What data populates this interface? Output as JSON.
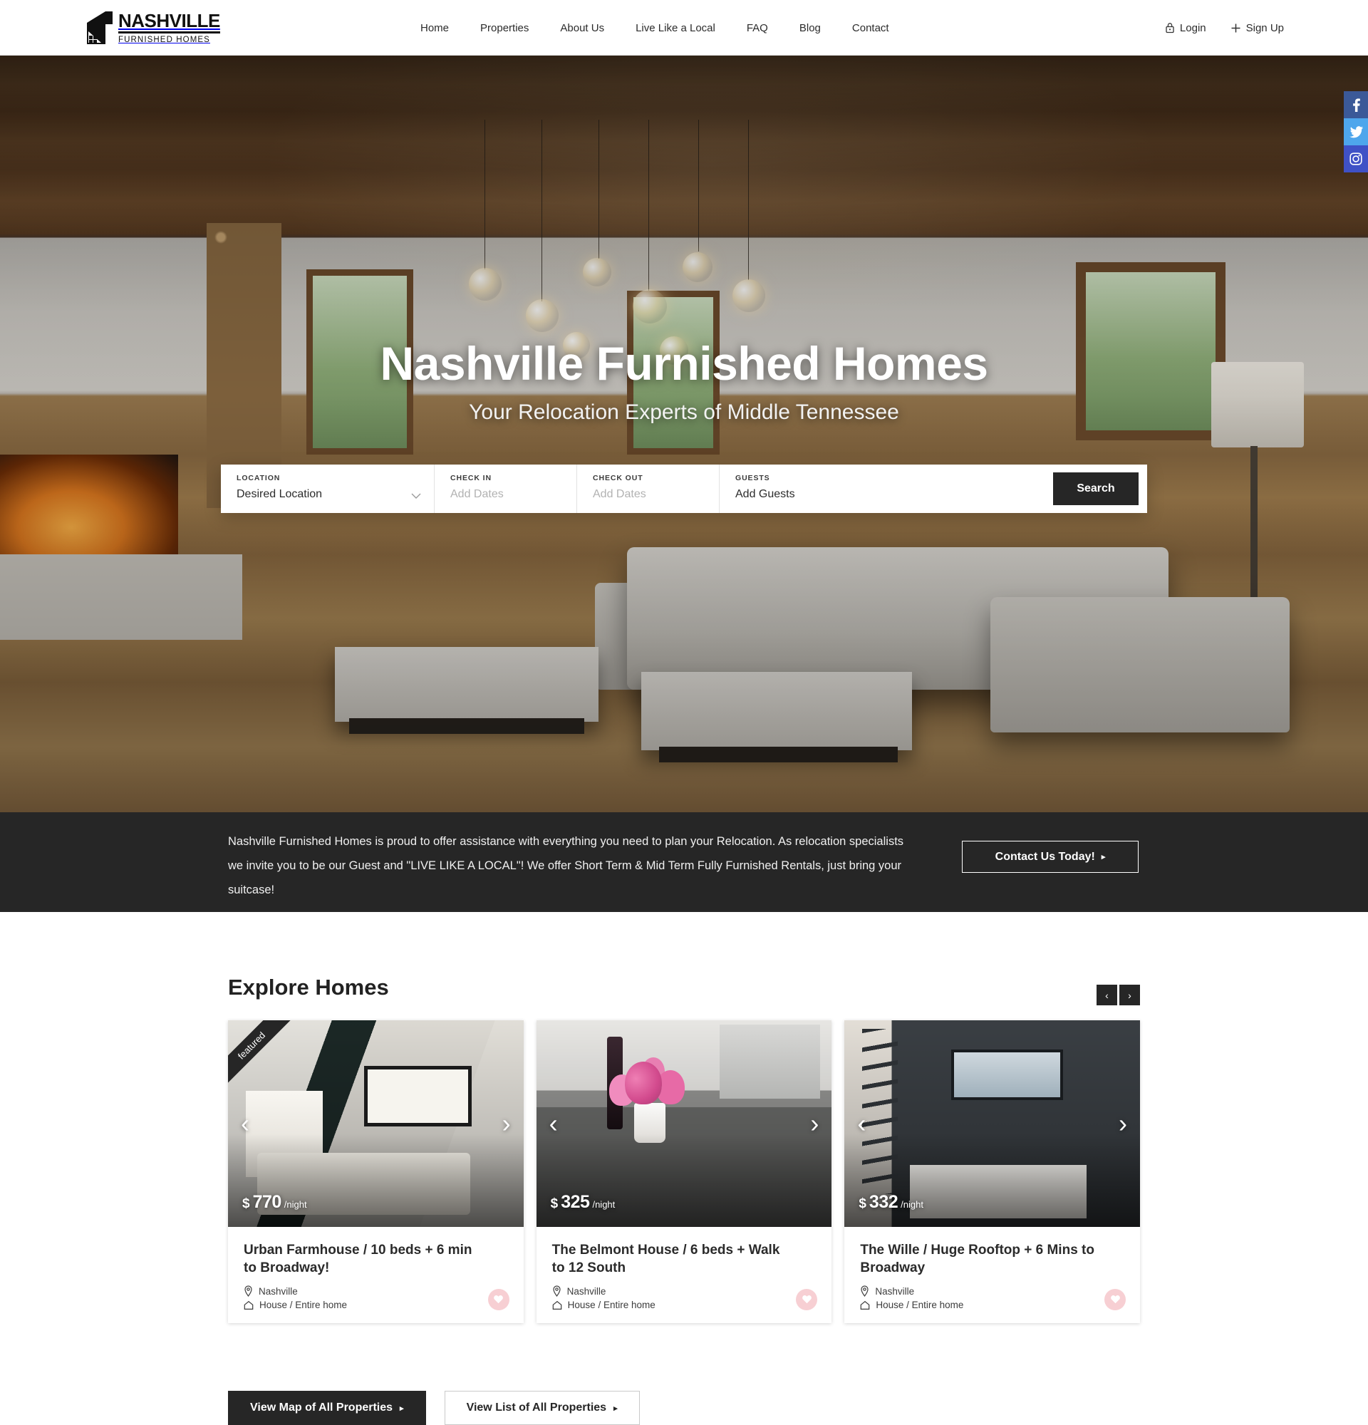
{
  "header": {
    "logo": {
      "line1": "NASHVILLE",
      "line2": "FURNISHED HOMES",
      "icon": "house-logo-icon"
    },
    "nav": [
      {
        "label": "Home"
      },
      {
        "label": "Properties"
      },
      {
        "label": "About Us"
      },
      {
        "label": "Live Like a Local"
      },
      {
        "label": "FAQ"
      },
      {
        "label": "Blog"
      },
      {
        "label": "Contact"
      }
    ],
    "login_label": "Login",
    "login_icon": "lock-icon",
    "signup_label": "Sign Up",
    "signup_icon": "plus-icon"
  },
  "social_rail": [
    {
      "name": "facebook-icon",
      "label": "f",
      "color": "#3b5998"
    },
    {
      "name": "twitter-icon",
      "label": "t",
      "color": "#4ea6ec"
    },
    {
      "name": "instagram-icon",
      "label": "ig",
      "color": "#3f51c6"
    }
  ],
  "hero": {
    "title": "Nashville Furnished Homes",
    "subtitle": "Your Relocation Experts of Middle Tennessee"
  },
  "search": {
    "location_label": "LOCATION",
    "location_value": "Desired Location",
    "checkin_label": "CHECK IN",
    "checkin_placeholder": "Add Dates",
    "checkout_label": "CHECK OUT",
    "checkout_placeholder": "Add Dates",
    "guests_label": "GUESTS",
    "guests_value": "Add Guests",
    "button_label": "Search"
  },
  "band": {
    "text": "Nashville Furnished Homes is proud to offer assistance with everything you need to plan your Relocation. As relocation specialists we invite you to be our Guest and \"LIVE LIKE A LOCAL\"! We offer Short Term & Mid Term Fully Furnished Rentals, just bring your suitcase!",
    "button_label": "Contact Us Today!",
    "button_arrow": "▸",
    "background": "#262626"
  },
  "explore": {
    "title": "Explore Homes",
    "prev_icon": "chevron-left-icon",
    "next_icon": "chevron-right-icon",
    "prev_glyph": "‹",
    "next_glyph": "›",
    "cards": [
      {
        "badge": "featured",
        "currency": "$",
        "price": "770",
        "unit": "/night",
        "title": "Urban Farmhouse / 10 beds + 6 min to Broadway!",
        "city": "Nashville",
        "type": "House / Entire home",
        "fav_color": "#f7cfd3"
      },
      {
        "badge": "",
        "currency": "$",
        "price": "325",
        "unit": "/night",
        "title": "The Belmont House / 6 beds + Walk to 12 South",
        "city": "Nashville",
        "type": "House / Entire home",
        "fav_color": "#f7cfd3"
      },
      {
        "badge": "",
        "currency": "$",
        "price": "332",
        "unit": "/night",
        "title": "The Wille / Huge Rooftop + 6 Mins to Broadway",
        "city": "Nashville",
        "type": "House / Entire home",
        "fav_color": "#f7cfd3"
      }
    ]
  },
  "bottom_buttons": [
    {
      "label": "View Map of All Properties",
      "arrow": "▸",
      "style": "dark"
    },
    {
      "label": "View List of All Properties",
      "arrow": "▸",
      "style": "light"
    }
  ]
}
